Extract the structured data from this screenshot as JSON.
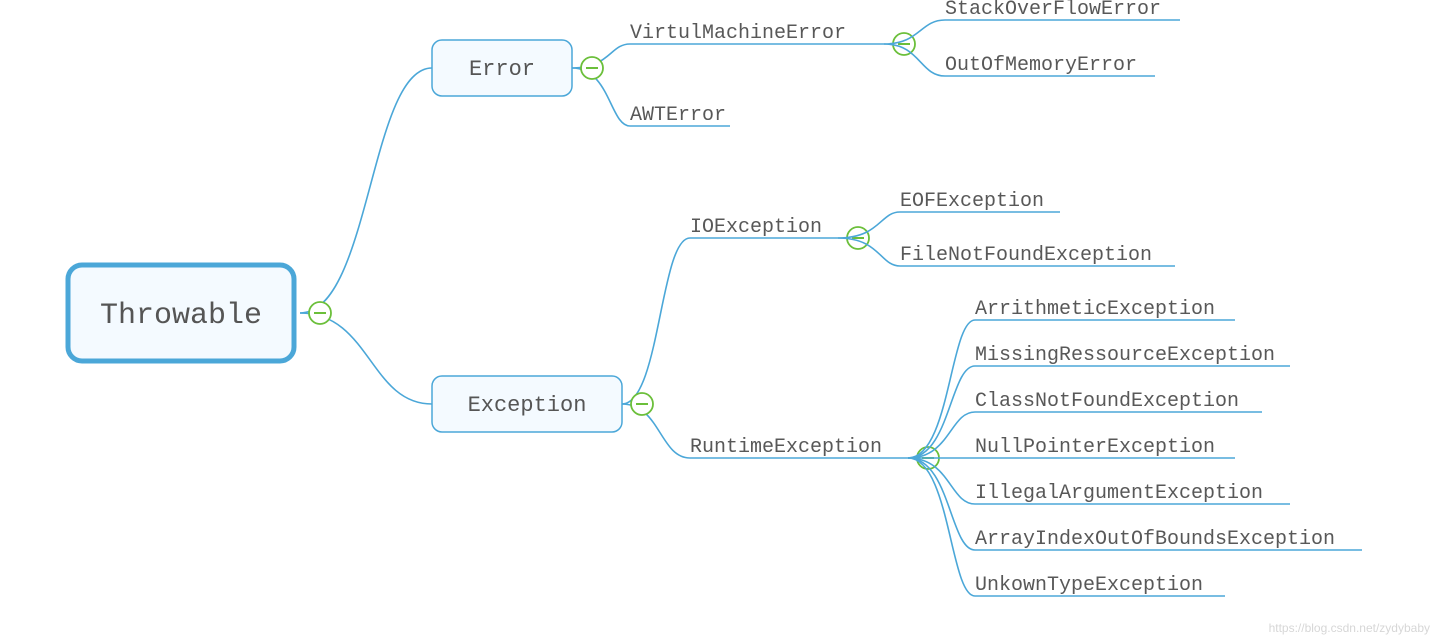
{
  "colors": {
    "stroke": "#4ba7d8",
    "fill": "#f4faff",
    "collapse": "#6bbf3a"
  },
  "root": {
    "label": "Throwable"
  },
  "level1": {
    "error": {
      "label": "Error"
    },
    "exception": {
      "label": "Exception"
    }
  },
  "level2": {
    "vmerror": {
      "label": "VirtulMachineError"
    },
    "awterror": {
      "label": "AWTError"
    },
    "ioexception": {
      "label": "IOException"
    },
    "runtime": {
      "label": "RuntimeException"
    }
  },
  "leaves": {
    "sof": {
      "label": "StackOverFlowError"
    },
    "oom": {
      "label": "OutOfMemoryError"
    },
    "eof": {
      "label": "EOFException"
    },
    "fnf": {
      "label": "FileNotFoundException"
    },
    "arith": {
      "label": "ArrithmeticException"
    },
    "missing": {
      "label": "MissingRessourceException"
    },
    "cnf": {
      "label": "ClassNotFoundException"
    },
    "npe": {
      "label": "NullPointerException"
    },
    "iae": {
      "label": "IllegalArgumentException"
    },
    "aioobe": {
      "label": "ArrayIndexOutOfBoundsException"
    },
    "ute": {
      "label": "UnkownTypeException"
    }
  },
  "watermark": "https://blog.csdn.net/zydybaby"
}
